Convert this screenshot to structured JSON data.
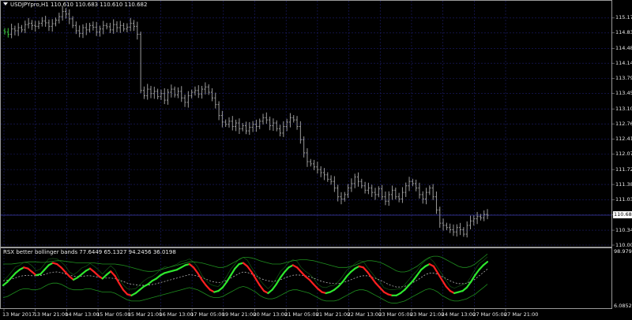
{
  "window": {
    "symbol_line": "USDJPYpro,H1  110.610 110.683 110.610 110.682",
    "indicator_line": "RSX better bollinger bands  77.6449 65.1327 94.2456 36.0198"
  },
  "colors": {
    "background": "#000000",
    "grid": "#1e1e6e",
    "bars": "#9a9a9a",
    "bid_line": "#3a3aa8",
    "rsx_up": "#2ee82e",
    "rsx_down": "#ff2020",
    "bands": "#1f8f1f",
    "mid": "#c8c8c8"
  },
  "chart_data": [
    {
      "type": "bar",
      "title": "USDJPYpro,H1",
      "ylim": [
        110.0,
        115.4
      ],
      "y_ticks": [
        "115.170",
        "114.830",
        "114.480",
        "114.140",
        "113.790",
        "113.450",
        "113.100",
        "112.760",
        "112.410",
        "112.070",
        "111.720",
        "111.380",
        "111.030",
        "110.690",
        "110.340",
        "110.000"
      ],
      "current_price": "110.682",
      "closes": [
        114.85,
        114.8,
        114.92,
        114.88,
        114.95,
        114.9,
        115.02,
        115.05,
        115.0,
        114.98,
        115.05,
        115.1,
        115.06,
        114.98,
        115.04,
        115.12,
        115.2,
        115.32,
        115.26,
        115.15,
        115.0,
        114.88,
        114.82,
        114.95,
        114.9,
        115.0,
        114.96,
        114.85,
        114.92,
        115.0,
        114.97,
        114.9,
        115.02,
        114.95,
        115.0,
        114.92,
        114.96,
        115.05,
        114.98,
        114.8,
        113.52,
        113.4,
        113.55,
        113.45,
        113.5,
        113.38,
        113.45,
        113.3,
        113.48,
        113.55,
        113.42,
        113.5,
        113.35,
        113.25,
        113.4,
        113.48,
        113.52,
        113.44,
        113.55,
        113.6,
        113.48,
        113.35,
        113.2,
        112.95,
        112.8,
        112.75,
        112.82,
        112.7,
        112.78,
        112.65,
        112.72,
        112.6,
        112.68,
        112.75,
        112.7,
        112.82,
        112.9,
        112.85,
        112.72,
        112.78,
        112.65,
        112.55,
        112.7,
        112.8,
        112.9,
        112.85,
        112.7,
        112.4,
        112.1,
        111.9,
        111.85,
        111.78,
        111.72,
        111.65,
        111.6,
        111.5,
        111.45,
        111.3,
        111.1,
        111.05,
        111.15,
        111.3,
        111.4,
        111.55,
        111.45,
        111.35,
        111.25,
        111.3,
        111.2,
        111.15,
        111.28,
        111.1,
        111.0,
        111.15,
        111.25,
        111.1,
        111.05,
        111.2,
        111.35,
        111.45,
        111.4,
        111.3,
        111.15,
        111.05,
        111.2,
        111.3,
        111.1,
        110.8,
        110.5,
        110.45,
        110.4,
        110.35,
        110.3,
        110.4,
        110.35,
        110.25,
        110.45,
        110.55,
        110.6,
        110.65,
        110.62,
        110.7,
        110.68
      ]
    },
    {
      "type": "line",
      "title": "RSX better bollinger bands",
      "values": [
        "77.6449",
        "65.1327",
        "94.2456",
        "36.0198"
      ],
      "y_ticks": [
        "98.9793",
        "6.08524"
      ],
      "ylim": [
        0,
        100
      ],
      "series": [
        {
          "values": [
            38,
            44,
            52,
            60,
            66,
            70,
            68,
            62,
            56,
            58,
            66,
            74,
            78,
            76,
            70,
            62,
            54,
            48,
            52,
            58,
            64,
            68,
            62,
            55,
            50,
            57,
            63,
            55,
            42,
            30,
            22,
            20,
            24,
            30,
            36,
            40,
            46,
            50,
            56,
            60,
            62,
            64,
            66,
            70,
            74,
            76,
            70,
            60,
            48,
            38,
            30,
            26,
            28,
            34,
            44,
            56,
            68,
            76,
            78,
            72,
            62,
            50,
            38,
            28,
            24,
            30,
            40,
            52,
            62,
            70,
            74,
            70,
            62,
            54,
            48,
            40,
            32,
            26,
            24,
            26,
            30,
            36,
            44,
            54,
            62,
            68,
            72,
            70,
            62,
            52,
            42,
            34,
            26,
            22,
            20,
            20,
            24,
            30,
            38,
            46,
            56,
            66,
            72,
            76,
            72,
            60,
            48,
            36,
            28,
            24,
            26,
            28,
            34,
            44,
            56,
            66,
            74,
            80
          ]
        },
        {
          "values": [
            76,
            76,
            76,
            77,
            78,
            79,
            80,
            80,
            80,
            79,
            79,
            80,
            81,
            82,
            82,
            81,
            80,
            79,
            78,
            78,
            78,
            78,
            78,
            77,
            76,
            76,
            76,
            76,
            75,
            74,
            72,
            70,
            68,
            66,
            64,
            63,
            63,
            64,
            66,
            68,
            70,
            72,
            74,
            76,
            78,
            80,
            80,
            79,
            78,
            76,
            74,
            72,
            70,
            70,
            72,
            76,
            80,
            84,
            88,
            88,
            87,
            85,
            82,
            80,
            78,
            76,
            76,
            76,
            78,
            80,
            82,
            83,
            84,
            84,
            83,
            82,
            80,
            78,
            76,
            74,
            72,
            70,
            70,
            70,
            72,
            74,
            77,
            80,
            82,
            82,
            81,
            79,
            76,
            72,
            68,
            64,
            62,
            62,
            64,
            68,
            72,
            78,
            84,
            88,
            90,
            90,
            88,
            84,
            80,
            76,
            72,
            70,
            70,
            72,
            76,
            82,
            88,
            94
          ]
        },
        {
          "values": [
            16,
            18,
            22,
            26,
            30,
            32,
            32,
            30,
            30,
            32,
            36,
            40,
            42,
            42,
            40,
            36,
            32,
            30,
            30,
            30,
            32,
            32,
            30,
            28,
            26,
            26,
            26,
            24,
            20,
            16,
            12,
            10,
            10,
            10,
            12,
            14,
            16,
            18,
            20,
            22,
            24,
            26,
            28,
            30,
            32,
            34,
            32,
            30,
            26,
            22,
            18,
            16,
            16,
            18,
            22,
            26,
            30,
            34,
            36,
            34,
            30,
            26,
            20,
            16,
            14,
            14,
            16,
            20,
            24,
            28,
            30,
            30,
            28,
            26,
            24,
            20,
            16,
            12,
            10,
            10,
            10,
            12,
            16,
            20,
            24,
            28,
            30,
            30,
            28,
            24,
            20,
            16,
            12,
            8,
            6,
            6,
            8,
            10,
            14,
            18,
            22,
            26,
            30,
            32,
            30,
            26,
            20,
            16,
            12,
            10,
            10,
            12,
            14,
            18,
            22,
            28,
            34,
            40
          ]
        }
      ]
    }
  ],
  "time_axis": [
    "13 Mar 2017",
    "13 Mar 21:00",
    "14 Mar 13:00",
    "15 Mar 05:00",
    "15 Mar 21:00",
    "16 Mar 13:00",
    "17 Mar 05:00",
    "19 Mar 21:00",
    "20 Mar 13:00",
    "21 Mar 05:00",
    "21 Mar 21:00",
    "22 Mar 13:00",
    "23 Mar 05:00",
    "23 Mar 21:00",
    "24 Mar 13:00",
    "27 Mar 05:00",
    "27 Mar 21:00"
  ]
}
